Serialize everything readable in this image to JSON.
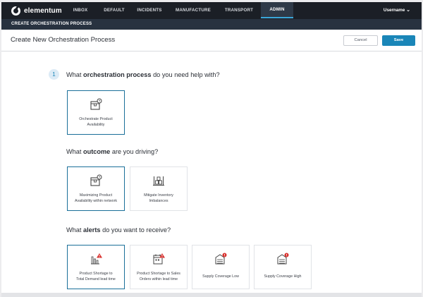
{
  "brand": {
    "name": "elementum"
  },
  "nav": {
    "tabs": [
      {
        "label": "INBOX"
      },
      {
        "label": "DEFAULT"
      },
      {
        "label": "INCIDENTS"
      },
      {
        "label": "MANUFACTURE"
      },
      {
        "label": "TRANSPORT"
      },
      {
        "label": "ADMIN",
        "active": true
      }
    ],
    "user_label": "Username",
    "user_caret": "⌄"
  },
  "subbar": {
    "label": "CREATE ORCHESTRATION PROCESS"
  },
  "header": {
    "title": "Create New Orchestration Process",
    "cancel_label": "Cancel",
    "save_label": "Save"
  },
  "step": {
    "number": "1"
  },
  "questions": {
    "process": {
      "pre": "What ",
      "bold": "orchestration process",
      "post": " do you need help with?"
    },
    "outcome": {
      "pre": "What ",
      "bold": "outcome",
      "post": " are you driving?"
    },
    "alerts": {
      "pre": "What ",
      "bold": "alerts",
      "post": " do you want to receive?"
    }
  },
  "process_cards": [
    {
      "line1": "Orchestrate Product",
      "line2": "Availability",
      "icon": "box-clock-icon",
      "selected": true
    }
  ],
  "outcome_cards": [
    {
      "line1": "Maximizing Product",
      "line2": "Availability within network",
      "icon": "box-clock-icon",
      "selected": true
    },
    {
      "line1": "Mitigate Inventory",
      "line2": "Imbalances",
      "icon": "pallet-icon",
      "selected": false
    }
  ],
  "alert_cards": [
    {
      "line1": "Product Shortage to",
      "line2": "Total Demand lead time",
      "icon": "chart-warning-icon",
      "selected": true
    },
    {
      "line1": "Product Shortage to Sales",
      "line2": "Orders within lead time",
      "icon": "calendar-warning-icon",
      "selected": false
    },
    {
      "line1": "Supply Coverage Low",
      "line2": "",
      "icon": "warehouse-alert-icon",
      "selected": false
    },
    {
      "line1": "Supply Coverage High",
      "line2": "",
      "icon": "warehouse-alert-icon",
      "selected": false
    }
  ],
  "colors": {
    "accent": "#1a86b8",
    "topbar": "#1b1f26",
    "alert_red": "#d9322f"
  }
}
